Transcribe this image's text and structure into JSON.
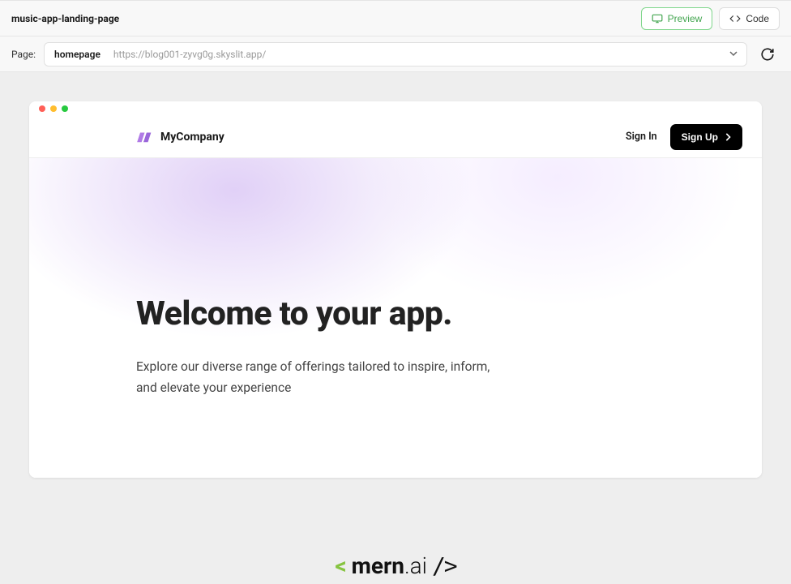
{
  "toolbar": {
    "project_name": "music-app-landing-page",
    "preview_label": "Preview",
    "code_label": "Code"
  },
  "pagebar": {
    "label": "Page:",
    "selected_name": "homepage",
    "selected_url": "https://blog001-zyvg0g.skyslit.app/"
  },
  "site": {
    "brand_name": "MyCompany",
    "signin_label": "Sign In",
    "signup_label": "Sign Up",
    "hero_title": "Welcome to your app.",
    "hero_subtitle": "Explore our diverse range of offerings tailored to inspire, inform, and elevate your experience"
  },
  "footer": {
    "name": "mern",
    "suffix": ".ai"
  }
}
